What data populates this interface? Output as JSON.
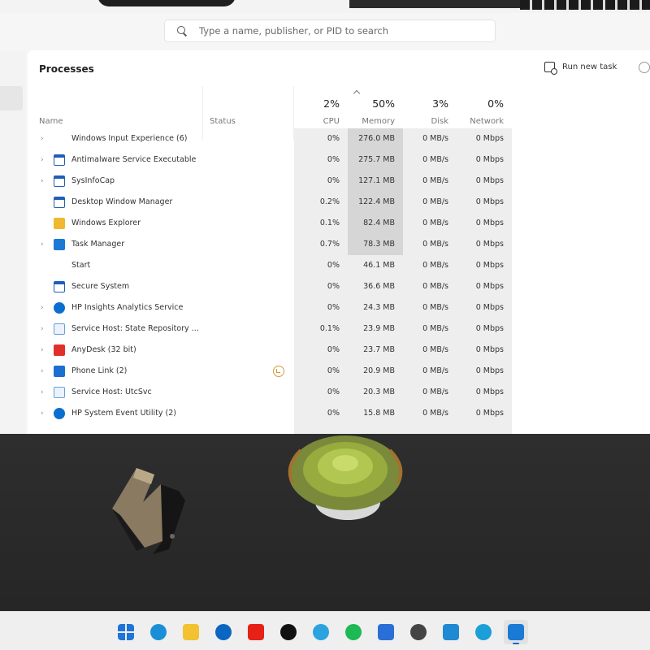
{
  "search": {
    "placeholder": "Type a name, publisher, or PID to search"
  },
  "header": {
    "title": "Processes",
    "run_new_task_label": "Run new task"
  },
  "columns": {
    "name": "Name",
    "status": "Status",
    "cpu": {
      "percent": "2%",
      "label": "CPU"
    },
    "memory": {
      "percent": "50%",
      "label": "Memory"
    },
    "disk": {
      "percent": "3%",
      "label": "Disk"
    },
    "network": {
      "percent": "0%",
      "label": "Network"
    }
  },
  "processes": [
    {
      "name": "Windows Input Experience (6)",
      "expandable": true,
      "icon": "none",
      "cpu": "0%",
      "memory": "276.0 MB",
      "disk": "0 MB/s",
      "network": "0 Mbps"
    },
    {
      "name": "Antimalware Service Executable",
      "expandable": true,
      "icon": "app-window-icon",
      "cpu": "0%",
      "memory": "275.7 MB",
      "disk": "0 MB/s",
      "network": "0 Mbps"
    },
    {
      "name": "SysInfoCap",
      "expandable": true,
      "icon": "app-window-icon",
      "cpu": "0%",
      "memory": "127.1 MB",
      "disk": "0 MB/s",
      "network": "0 Mbps"
    },
    {
      "name": "Desktop Window Manager",
      "expandable": false,
      "icon": "app-window-icon",
      "cpu": "0.2%",
      "memory": "122.4 MB",
      "disk": "0 MB/s",
      "network": "0 Mbps"
    },
    {
      "name": "Windows Explorer",
      "expandable": false,
      "icon": "folder-icon",
      "cpu": "0.1%",
      "memory": "82.4 MB",
      "disk": "0 MB/s",
      "network": "0 Mbps"
    },
    {
      "name": "Task Manager",
      "expandable": true,
      "icon": "task-manager-icon",
      "cpu": "0.7%",
      "memory": "78.3 MB",
      "disk": "0 MB/s",
      "network": "0 Mbps"
    },
    {
      "name": "Start",
      "expandable": false,
      "icon": "none",
      "cpu": "0%",
      "memory": "46.1 MB",
      "disk": "0 MB/s",
      "network": "0 Mbps"
    },
    {
      "name": "Secure System",
      "expandable": false,
      "icon": "app-window-icon",
      "cpu": "0%",
      "memory": "36.6 MB",
      "disk": "0 MB/s",
      "network": "0 Mbps"
    },
    {
      "name": "HP Insights Analytics Service",
      "expandable": true,
      "icon": "hp-icon",
      "cpu": "0%",
      "memory": "24.3 MB",
      "disk": "0 MB/s",
      "network": "0 Mbps"
    },
    {
      "name": "Service Host: State Repository ...",
      "expandable": true,
      "icon": "service-host-icon",
      "cpu": "0.1%",
      "memory": "23.9 MB",
      "disk": "0 MB/s",
      "network": "0 Mbps"
    },
    {
      "name": "AnyDesk (32 bit)",
      "expandable": true,
      "icon": "anydesk-icon",
      "cpu": "0%",
      "memory": "23.7 MB",
      "disk": "0 MB/s",
      "network": "0 Mbps"
    },
    {
      "name": "Phone Link (2)",
      "expandable": true,
      "icon": "phone-link-icon",
      "cpu": "0%",
      "memory": "20.9 MB",
      "disk": "0 MB/s",
      "network": "0 Mbps",
      "efficiency": true
    },
    {
      "name": "Service Host: UtcSvc",
      "expandable": true,
      "icon": "service-host-icon",
      "cpu": "0%",
      "memory": "20.3 MB",
      "disk": "0 MB/s",
      "network": "0 Mbps"
    },
    {
      "name": "HP System Event Utility (2)",
      "expandable": true,
      "icon": "hp-icon",
      "cpu": "0%",
      "memory": "15.8 MB",
      "disk": "0 MB/s",
      "network": "0 Mbps"
    }
  ],
  "taskbar": [
    {
      "name": "start-icon",
      "color": "#1e74d8"
    },
    {
      "name": "edge-icon",
      "color": "#1a8fd8"
    },
    {
      "name": "file-explorer-icon",
      "color": "#f2c230"
    },
    {
      "name": "hp-icon",
      "color": "#0a66c2"
    },
    {
      "name": "youtube-icon",
      "color": "#e62117"
    },
    {
      "name": "terminal-app-icon",
      "color": "#111111"
    },
    {
      "name": "telegram-icon",
      "color": "#2aa3e0"
    },
    {
      "name": "spotify-icon",
      "color": "#1db954"
    },
    {
      "name": "store-icon",
      "color": "#2a6fd6"
    },
    {
      "name": "fingerprint-icon",
      "color": "#444444"
    },
    {
      "name": "vscode-icon",
      "color": "#1f8ad2"
    },
    {
      "name": "teams-icon",
      "color": "#1a9fd8"
    },
    {
      "name": "task-manager-icon",
      "color": "#1a7ad6"
    }
  ],
  "colors": {
    "memory_highlight": "#d6d6d6",
    "column_shade": "#eeeeee",
    "accent": "#0a66d6"
  }
}
